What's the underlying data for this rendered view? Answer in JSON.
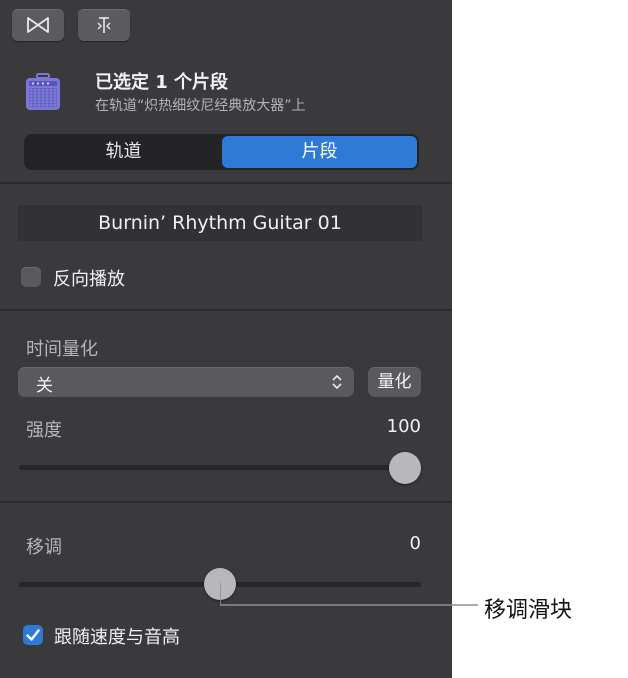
{
  "toolbar": {
    "buttons": [
      {
        "name": "bowtie-icon"
      },
      {
        "name": "split-pin-icon"
      }
    ]
  },
  "header": {
    "icon": "amp-icon",
    "title": "已选定 1 个片段",
    "subtitle": "在轨道“炽热细纹尼经典放大器”上"
  },
  "tabs": {
    "items": [
      "轨道",
      "片段"
    ],
    "active_index": 1
  },
  "region": {
    "name": "Burnin’ Rhythm Guitar 01",
    "reverse_label": "反向播放",
    "reverse_checked": false
  },
  "quantize": {
    "section_label": "时间量化",
    "selected": "关",
    "button_label": "量化",
    "strength_label": "强度",
    "strength_value": "100"
  },
  "transpose": {
    "label": "移调",
    "value": "0",
    "slider_fraction": 0.5,
    "follow_label": "跟随速度与音高",
    "follow_checked": true
  },
  "callout": {
    "text": "移调滑块"
  },
  "colors": {
    "panel_bg": "#3a3a3c",
    "accent": "#2e7ad6",
    "amp_icon": "#7b78d8"
  }
}
